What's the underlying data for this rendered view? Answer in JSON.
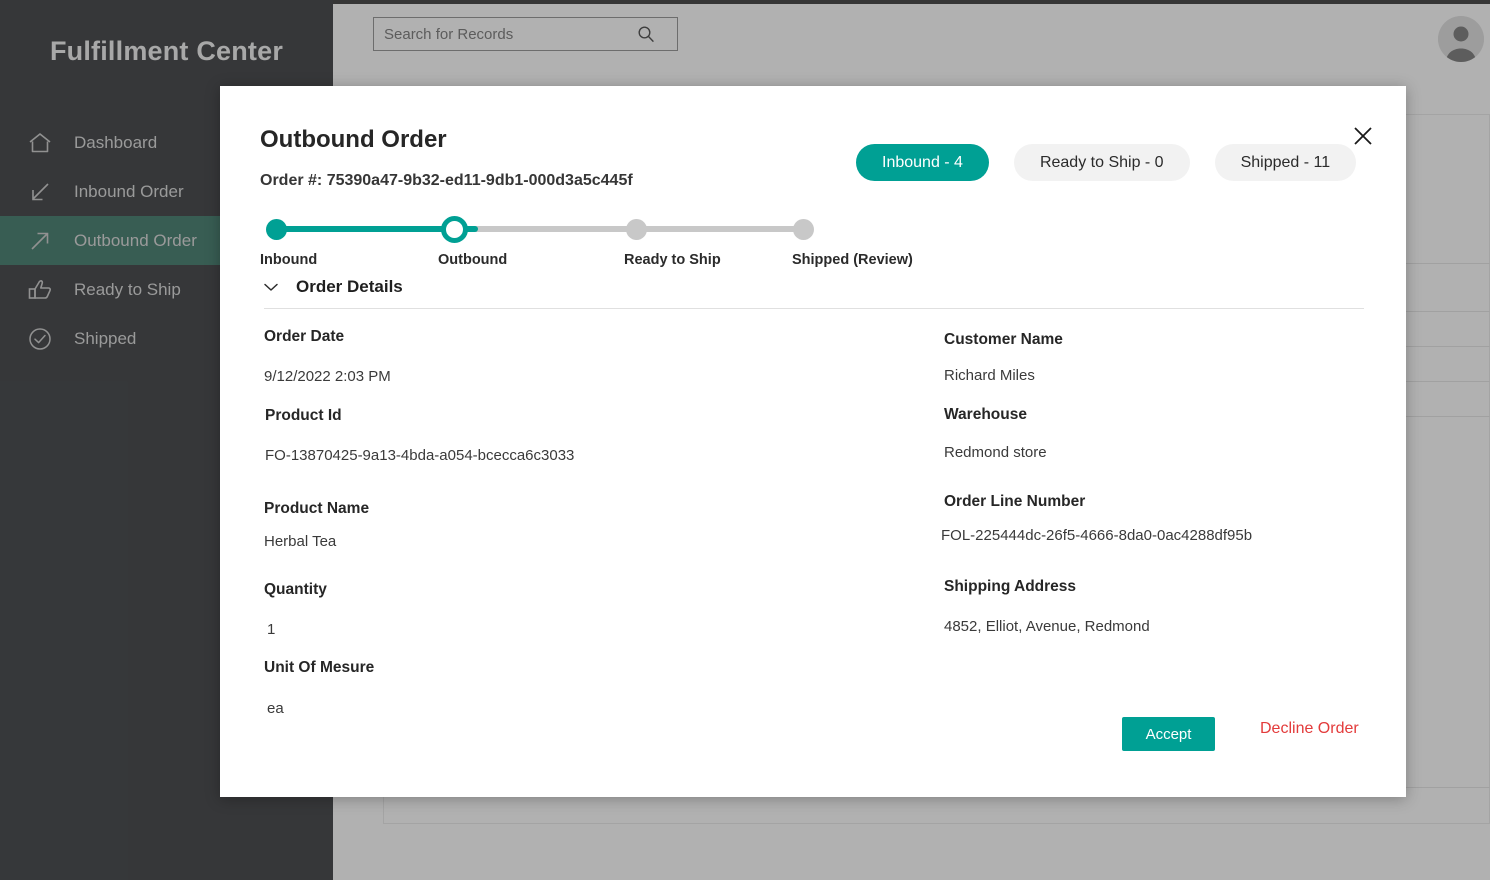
{
  "app": {
    "brand": "Fulfillment Center",
    "sidebar": {
      "items": [
        {
          "label": "Dashboard",
          "icon": "home-icon",
          "active": false
        },
        {
          "label": "Inbound Order",
          "icon": "arrow-down-left-icon",
          "active": false
        },
        {
          "label": "Outbound Order",
          "icon": "arrow-up-right-icon",
          "active": true
        },
        {
          "label": "Ready to Ship",
          "icon": "thumbs-up-icon",
          "active": false
        },
        {
          "label": "Shipped",
          "icon": "check-circle-icon",
          "active": false
        }
      ]
    },
    "search": {
      "placeholder": "Search for Records",
      "value": "",
      "icon": "search-icon"
    },
    "avatar": {
      "icon": "user-avatar-icon"
    }
  },
  "modal": {
    "title": "Outbound Order",
    "order_number_label": "Order #: 75390a47-9b32-ed11-9db1-000d3a5c445f",
    "close_icon": "close-icon",
    "tabs": [
      {
        "label": "Inbound - 4",
        "active": true
      },
      {
        "label": "Ready to Ship - 0",
        "active": false
      },
      {
        "label": "Shipped - 11",
        "active": false
      }
    ],
    "stepper": {
      "steps": [
        {
          "label": "Inbound",
          "state": "done"
        },
        {
          "label": "Outbound",
          "state": "current"
        },
        {
          "label": "Ready to Ship",
          "state": "todo"
        },
        {
          "label": "Shipped (Review)",
          "state": "todo"
        }
      ]
    },
    "accordion": {
      "title": "Order Details",
      "chevron_icon": "chevron-down-icon",
      "expanded": true
    },
    "fields_left": [
      {
        "label": "Order Date",
        "value": " 9/12/2022 2:03 PM"
      },
      {
        "label": "Product Id",
        "value": "FO-13870425-9a13-4bda-a054-bcecca6c3033"
      },
      {
        "label": "Product Name",
        "value": "Herbal Tea"
      },
      {
        "label": "Quantity",
        "value": "1"
      },
      {
        "label": "Unit Of Mesure",
        "value": "ea"
      }
    ],
    "fields_right": [
      {
        "label": "Customer Name",
        "value": " Richard Miles"
      },
      {
        "label": "Warehouse",
        "value": "Redmond store"
      },
      {
        "label": "Order Line Number",
        "value": "FOL-225444dc-26f5-4666-8da0-0ac4288df95b"
      },
      {
        "label": "Shipping Address",
        "value": "4852, Elliot, Avenue, Redmond"
      }
    ],
    "actions": {
      "accept_label": "Accept",
      "decline_label": "Decline Order"
    }
  },
  "colors": {
    "accent_teal": "#00a094",
    "sidebar_bg": "#2b2e31",
    "sidebar_active": "#2f6e5e",
    "decline_red": "#e33b3b",
    "step_idle": "#c8c8c8"
  }
}
